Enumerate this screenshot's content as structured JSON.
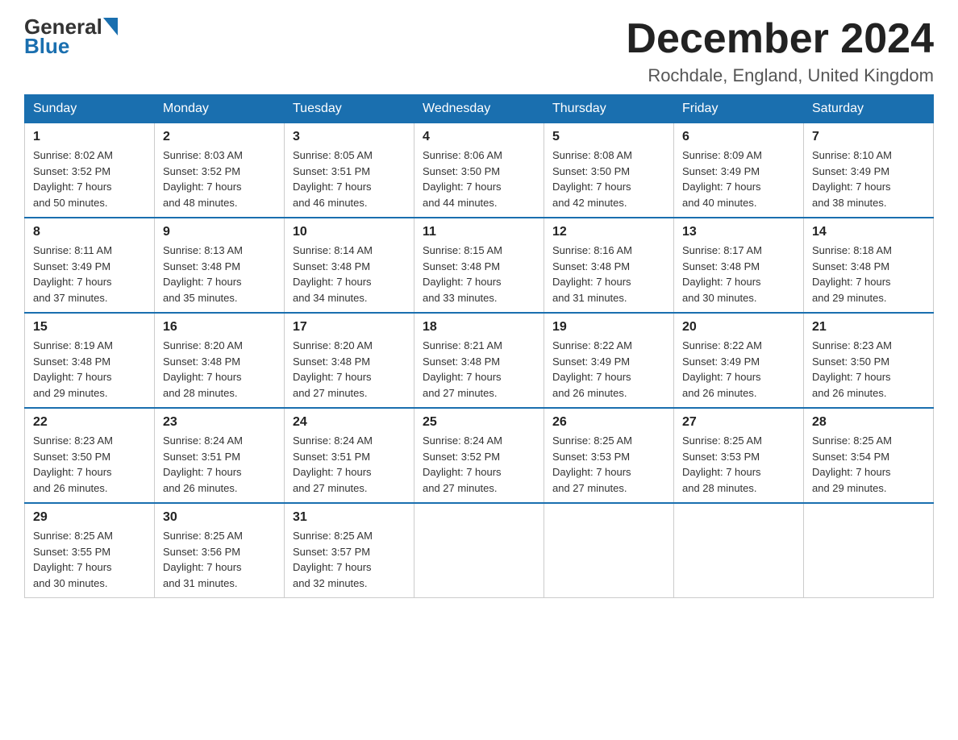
{
  "header": {
    "logo_general": "General",
    "logo_blue": "Blue",
    "month_title": "December 2024",
    "location": "Rochdale, England, United Kingdom"
  },
  "days_of_week": [
    "Sunday",
    "Monday",
    "Tuesday",
    "Wednesday",
    "Thursday",
    "Friday",
    "Saturday"
  ],
  "weeks": [
    [
      {
        "day": "1",
        "info": "Sunrise: 8:02 AM\nSunset: 3:52 PM\nDaylight: 7 hours\nand 50 minutes."
      },
      {
        "day": "2",
        "info": "Sunrise: 8:03 AM\nSunset: 3:52 PM\nDaylight: 7 hours\nand 48 minutes."
      },
      {
        "day": "3",
        "info": "Sunrise: 8:05 AM\nSunset: 3:51 PM\nDaylight: 7 hours\nand 46 minutes."
      },
      {
        "day": "4",
        "info": "Sunrise: 8:06 AM\nSunset: 3:50 PM\nDaylight: 7 hours\nand 44 minutes."
      },
      {
        "day": "5",
        "info": "Sunrise: 8:08 AM\nSunset: 3:50 PM\nDaylight: 7 hours\nand 42 minutes."
      },
      {
        "day": "6",
        "info": "Sunrise: 8:09 AM\nSunset: 3:49 PM\nDaylight: 7 hours\nand 40 minutes."
      },
      {
        "day": "7",
        "info": "Sunrise: 8:10 AM\nSunset: 3:49 PM\nDaylight: 7 hours\nand 38 minutes."
      }
    ],
    [
      {
        "day": "8",
        "info": "Sunrise: 8:11 AM\nSunset: 3:49 PM\nDaylight: 7 hours\nand 37 minutes."
      },
      {
        "day": "9",
        "info": "Sunrise: 8:13 AM\nSunset: 3:48 PM\nDaylight: 7 hours\nand 35 minutes."
      },
      {
        "day": "10",
        "info": "Sunrise: 8:14 AM\nSunset: 3:48 PM\nDaylight: 7 hours\nand 34 minutes."
      },
      {
        "day": "11",
        "info": "Sunrise: 8:15 AM\nSunset: 3:48 PM\nDaylight: 7 hours\nand 33 minutes."
      },
      {
        "day": "12",
        "info": "Sunrise: 8:16 AM\nSunset: 3:48 PM\nDaylight: 7 hours\nand 31 minutes."
      },
      {
        "day": "13",
        "info": "Sunrise: 8:17 AM\nSunset: 3:48 PM\nDaylight: 7 hours\nand 30 minutes."
      },
      {
        "day": "14",
        "info": "Sunrise: 8:18 AM\nSunset: 3:48 PM\nDaylight: 7 hours\nand 29 minutes."
      }
    ],
    [
      {
        "day": "15",
        "info": "Sunrise: 8:19 AM\nSunset: 3:48 PM\nDaylight: 7 hours\nand 29 minutes."
      },
      {
        "day": "16",
        "info": "Sunrise: 8:20 AM\nSunset: 3:48 PM\nDaylight: 7 hours\nand 28 minutes."
      },
      {
        "day": "17",
        "info": "Sunrise: 8:20 AM\nSunset: 3:48 PM\nDaylight: 7 hours\nand 27 minutes."
      },
      {
        "day": "18",
        "info": "Sunrise: 8:21 AM\nSunset: 3:48 PM\nDaylight: 7 hours\nand 27 minutes."
      },
      {
        "day": "19",
        "info": "Sunrise: 8:22 AM\nSunset: 3:49 PM\nDaylight: 7 hours\nand 26 minutes."
      },
      {
        "day": "20",
        "info": "Sunrise: 8:22 AM\nSunset: 3:49 PM\nDaylight: 7 hours\nand 26 minutes."
      },
      {
        "day": "21",
        "info": "Sunrise: 8:23 AM\nSunset: 3:50 PM\nDaylight: 7 hours\nand 26 minutes."
      }
    ],
    [
      {
        "day": "22",
        "info": "Sunrise: 8:23 AM\nSunset: 3:50 PM\nDaylight: 7 hours\nand 26 minutes."
      },
      {
        "day": "23",
        "info": "Sunrise: 8:24 AM\nSunset: 3:51 PM\nDaylight: 7 hours\nand 26 minutes."
      },
      {
        "day": "24",
        "info": "Sunrise: 8:24 AM\nSunset: 3:51 PM\nDaylight: 7 hours\nand 27 minutes."
      },
      {
        "day": "25",
        "info": "Sunrise: 8:24 AM\nSunset: 3:52 PM\nDaylight: 7 hours\nand 27 minutes."
      },
      {
        "day": "26",
        "info": "Sunrise: 8:25 AM\nSunset: 3:53 PM\nDaylight: 7 hours\nand 27 minutes."
      },
      {
        "day": "27",
        "info": "Sunrise: 8:25 AM\nSunset: 3:53 PM\nDaylight: 7 hours\nand 28 minutes."
      },
      {
        "day": "28",
        "info": "Sunrise: 8:25 AM\nSunset: 3:54 PM\nDaylight: 7 hours\nand 29 minutes."
      }
    ],
    [
      {
        "day": "29",
        "info": "Sunrise: 8:25 AM\nSunset: 3:55 PM\nDaylight: 7 hours\nand 30 minutes."
      },
      {
        "day": "30",
        "info": "Sunrise: 8:25 AM\nSunset: 3:56 PM\nDaylight: 7 hours\nand 31 minutes."
      },
      {
        "day": "31",
        "info": "Sunrise: 8:25 AM\nSunset: 3:57 PM\nDaylight: 7 hours\nand 32 minutes."
      },
      {
        "day": "",
        "info": ""
      },
      {
        "day": "",
        "info": ""
      },
      {
        "day": "",
        "info": ""
      },
      {
        "day": "",
        "info": ""
      }
    ]
  ]
}
